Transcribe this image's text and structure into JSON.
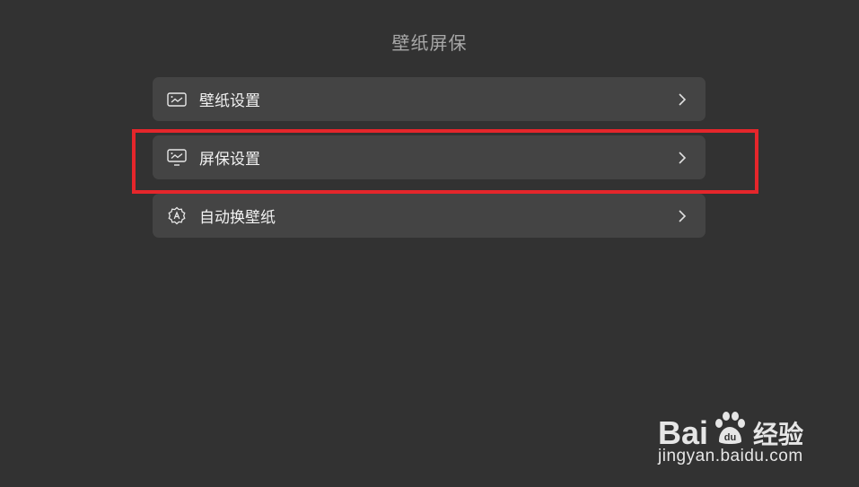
{
  "header": {
    "title": "壁纸屏保"
  },
  "menu": {
    "items": [
      {
        "label": "壁纸设置",
        "icon": "wallpaper-icon"
      },
      {
        "label": "屏保设置",
        "icon": "screensaver-icon"
      },
      {
        "label": "自动换壁纸",
        "icon": "auto-change-icon"
      }
    ]
  },
  "highlight": {
    "color": "#e5262b"
  },
  "watermark": {
    "brand_left": "Bai",
    "brand_right": "du",
    "brand_cn": "经验",
    "url": "jingyan.baidu.com"
  }
}
